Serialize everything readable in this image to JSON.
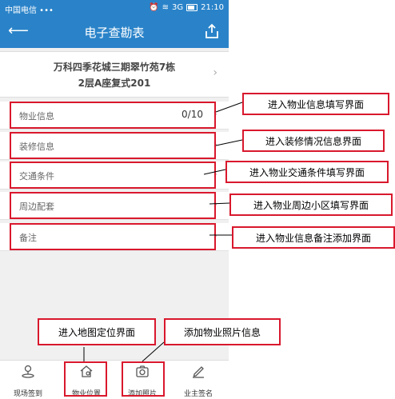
{
  "status_bar": {
    "carrier": "中国电信 •••",
    "time": "21:10",
    "network": "3G"
  },
  "header": {
    "title": "电子查勘表"
  },
  "property": {
    "address_line1": "万科四季花城三期翠竹苑7栋",
    "address_line2": "2层A座复式201"
  },
  "sections": [
    {
      "label": "物业信息",
      "value": "0/10"
    },
    {
      "label": "装修信息",
      "value": ""
    },
    {
      "label": "交通条件",
      "value": ""
    },
    {
      "label": "周边配套",
      "value": ""
    },
    {
      "label": "备注",
      "value": ""
    }
  ],
  "annotations": [
    "进入物业信息填写界面",
    "进入装修情况信息界面",
    "进入物业交通条件填写界面",
    "进入物业周边小区填写界面",
    "进入物业信息备注添加界面",
    "进入地图定位界面",
    "添加物业照片信息"
  ],
  "tabs": [
    {
      "label": "现场签到",
      "icon": "location-pin-icon"
    },
    {
      "label": "物业位置",
      "icon": "house-pin-icon"
    },
    {
      "label": "添加照片",
      "icon": "camera-icon"
    },
    {
      "label": "业主签名",
      "icon": "pen-icon"
    }
  ],
  "colors": {
    "primary": "#2a83c9",
    "highlight": "#d9182d"
  }
}
